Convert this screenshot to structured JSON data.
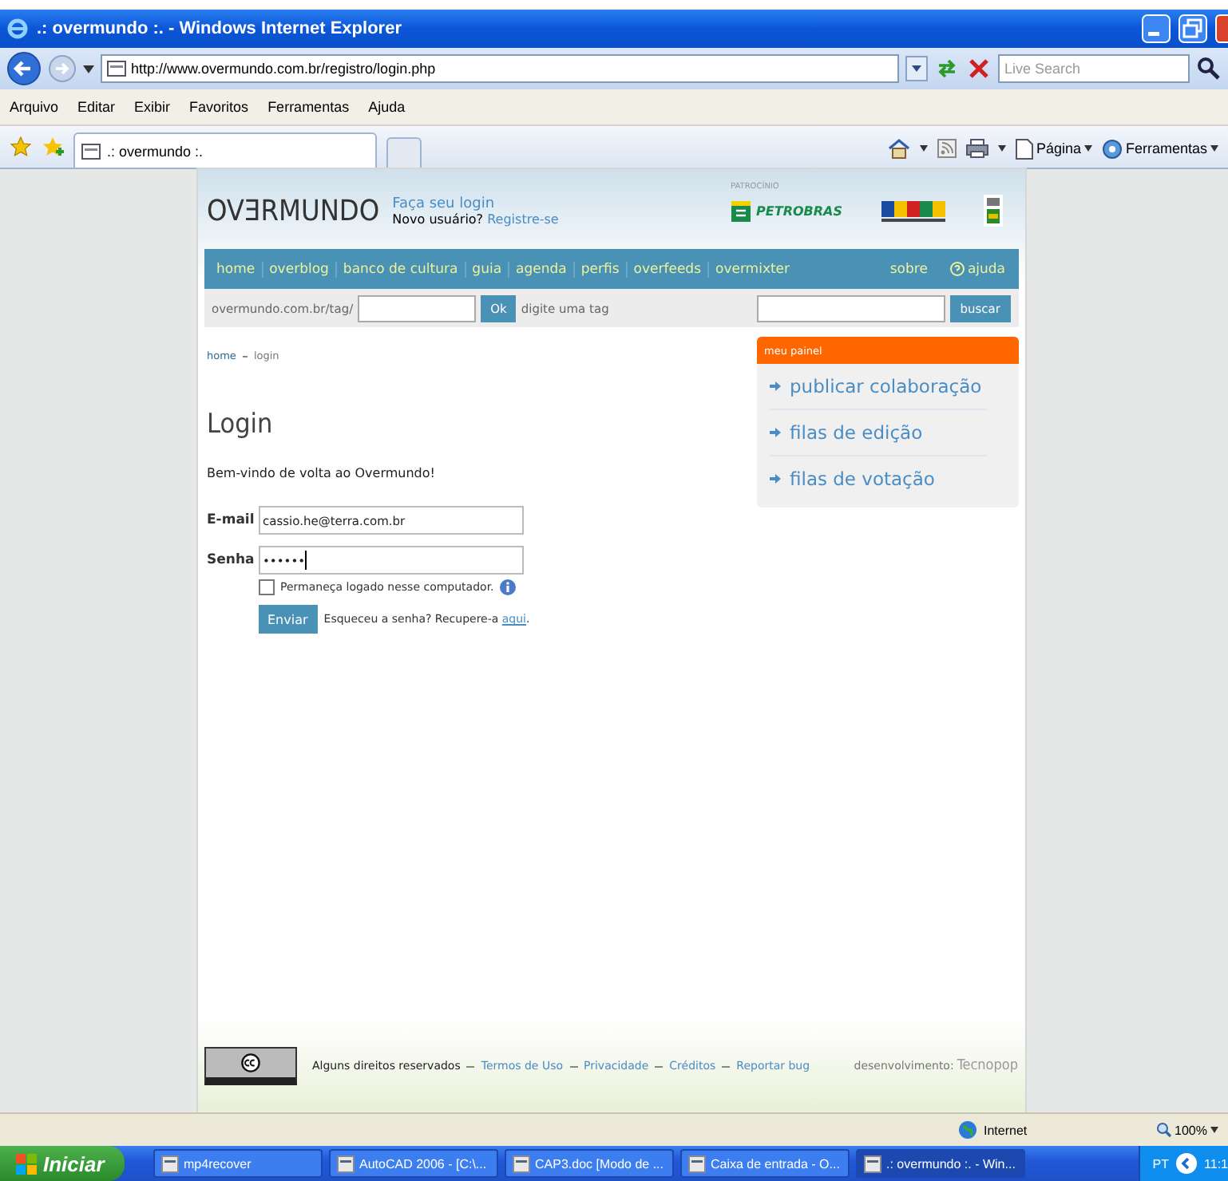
{
  "window": {
    "title": ".: overmundo :. - Windows Internet Explorer"
  },
  "address_bar": {
    "url": "http://www.overmundo.com.br/registro/login.php"
  },
  "search": {
    "placeholder": "Live Search"
  },
  "menu": [
    "Arquivo",
    "Editar",
    "Exibir",
    "Favoritos",
    "Ferramentas",
    "Ajuda"
  ],
  "tabs": [
    {
      "label": ".: overmundo :.",
      "selected": true
    }
  ],
  "command_bar": [
    "Página",
    "Ferramentas"
  ],
  "site": {
    "logo": "OVƎRMUNDO",
    "login_link": "Faça seu login",
    "new_user": "Novo usuário?",
    "register_link": "Registre-se",
    "sponsor_label": "PATROCÍNIO",
    "sponsor": "PETROBRAS",
    "nav": [
      "home",
      "overblog",
      "banco de cultura",
      "guia",
      "agenda",
      "perfis",
      "overfeeds",
      "overmixter"
    ],
    "nav_right": [
      "sobre",
      "ajuda"
    ],
    "tag_prefix": "overmundo.com.br/tag/",
    "tag_button": "Ok",
    "tag_hint": "digite uma tag",
    "search_button": "buscar",
    "breadcrumb": [
      {
        "label": "home",
        "kind": "link"
      },
      {
        "label": "login",
        "kind": "current"
      }
    ],
    "heading": "Login",
    "welcome": "Bem-vindo de volta ao Overmundo!",
    "fields": [
      {
        "label": "E-mail",
        "value": "cassio.he@terra.com.br",
        "kind": "text"
      },
      {
        "label": "Senha",
        "value": "••••••",
        "kind": "password"
      }
    ],
    "remember": {
      "label": "Permaneça logado nesse computador.",
      "checked": false
    },
    "submit": "Enviar",
    "forgot": {
      "text": "Esqueceu a senha? Recupere-a",
      "link": "aqui",
      "end": "."
    },
    "panel": {
      "title": "meu painel",
      "items": [
        "publicar colaboração",
        "filas de edição",
        "filas de votação"
      ]
    },
    "footer": {
      "rights": "Alguns direitos reservados",
      "links": [
        "Termos de Uso",
        "Privacidade",
        "Créditos",
        "Reportar bug"
      ],
      "dev_label": "desenvolvimento:",
      "dev": "Tecnopop"
    }
  },
  "status_bar": {
    "zone": "Internet",
    "zoom": "100%"
  },
  "taskbar": {
    "start": "Iniciar",
    "tasks": [
      {
        "label": "mp4recover",
        "selected": false
      },
      {
        "label": "AutoCAD 2006 - [C:\\...",
        "selected": false
      },
      {
        "label": "CAP3.doc [Modo de ...",
        "selected": false
      },
      {
        "label": "Caixa de entrada - O...",
        "selected": false
      },
      {
        "label": ".: overmundo :. - Win...",
        "selected": true
      }
    ],
    "language": "PT",
    "clock": "11:1"
  }
}
